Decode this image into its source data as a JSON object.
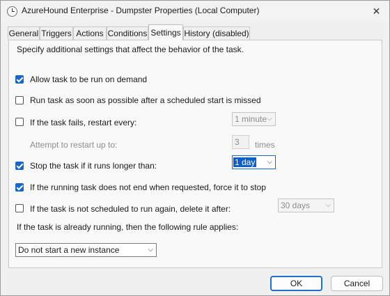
{
  "window": {
    "title": "AzureHound Enterprise - Dumpster Properties (Local Computer)",
    "close_glyph": "✕"
  },
  "tabs": [
    {
      "label": "General",
      "active": false
    },
    {
      "label": "Triggers",
      "active": false
    },
    {
      "label": "Actions",
      "active": false
    },
    {
      "label": "Conditions",
      "active": false
    },
    {
      "label": "Settings",
      "active": true
    },
    {
      "label": "History (disabled)",
      "active": false
    }
  ],
  "settings": {
    "intro": "Specify additional settings that affect the behavior of the task.",
    "allow_on_demand": {
      "label": "Allow task to be run on demand",
      "checked": true
    },
    "run_asap": {
      "label": "Run task as soon as possible after a scheduled start is missed",
      "checked": false
    },
    "restart_on_fail": {
      "label": "If the task fails, restart every:",
      "checked": false,
      "interval": "1 minute"
    },
    "restart_attempts": {
      "label": "Attempt to restart up to:",
      "value": "3",
      "unit": "times"
    },
    "stop_if_longer": {
      "label": "Stop the task if it runs longer than:",
      "checked": true,
      "duration": "1 day"
    },
    "force_stop": {
      "label": "If the running task does not end when requested, force it to stop",
      "checked": true
    },
    "delete_after": {
      "label": "If the task is not scheduled to run again, delete it after:",
      "checked": false,
      "duration": "30 days"
    },
    "rule_label": "If the task is already running, then the following rule applies:",
    "rule_value": "Do not start a new instance"
  },
  "buttons": {
    "ok": "OK",
    "cancel": "Cancel"
  },
  "icons": {
    "combo_arrow": "⌵"
  }
}
